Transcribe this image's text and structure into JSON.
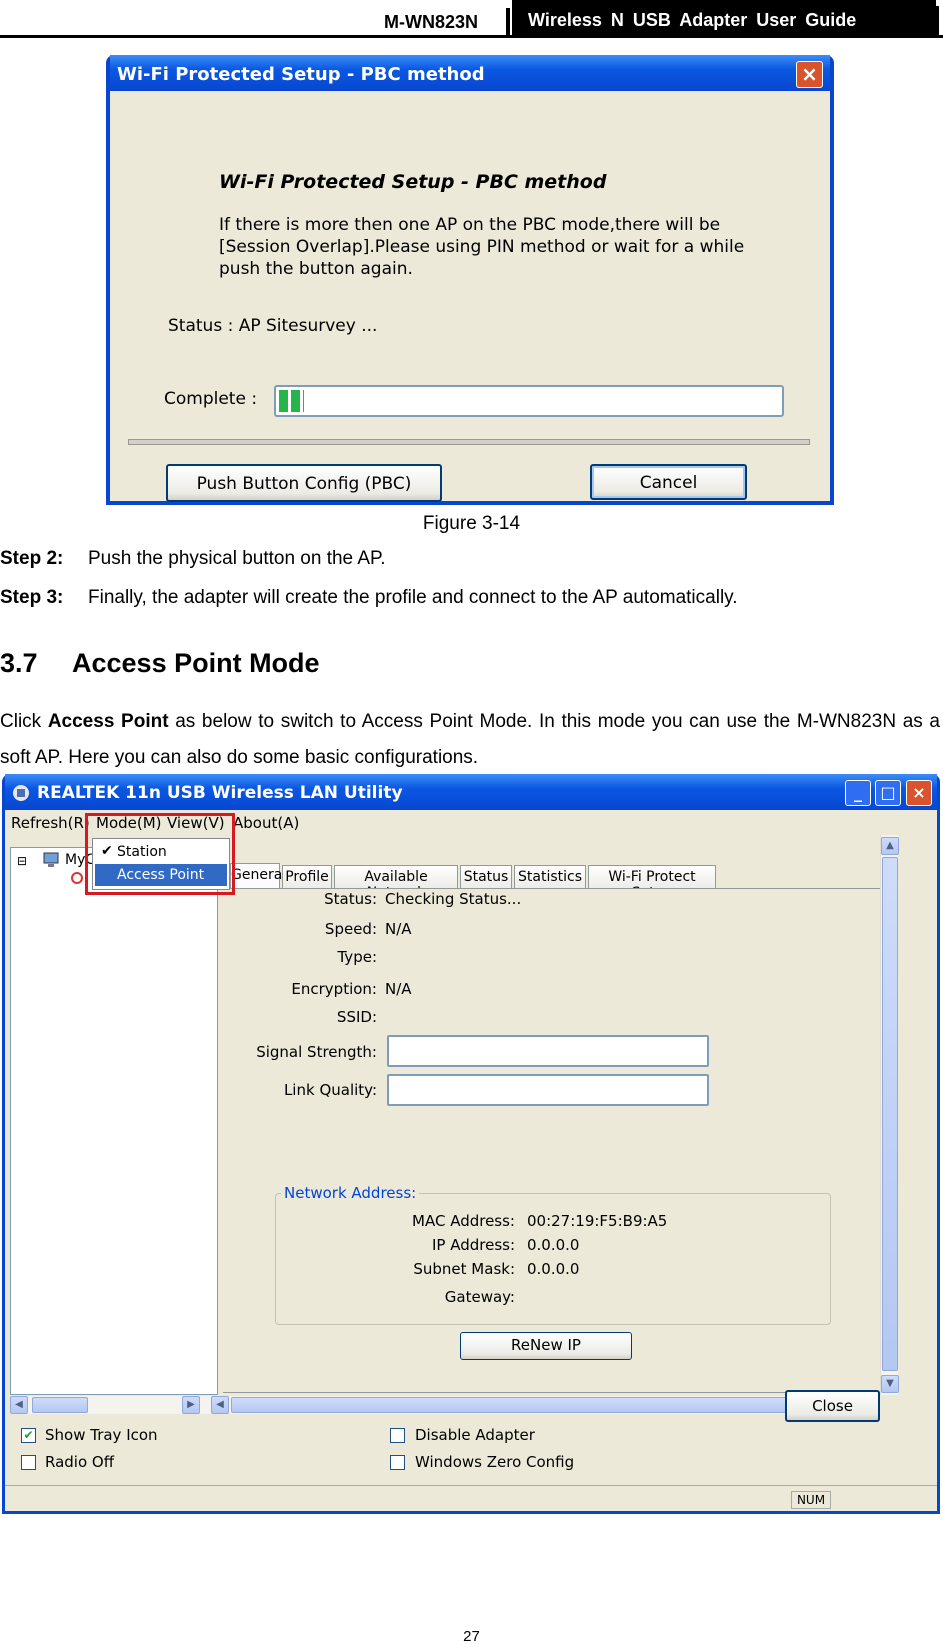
{
  "header": {
    "model": "M-WN823N",
    "guide": "Wireless N USB Adapter User Guide"
  },
  "dialog1": {
    "title": "Wi-Fi Protected Setup - PBC method",
    "close_icon": "close-icon",
    "heading": "Wi-Fi Protected Setup - PBC method",
    "message": "If there is more then one AP on the PBC mode,there will be [Session Overlap].Please using PIN method or wait for a while push the button again.",
    "status": "Status : AP Sitesurvey ...",
    "complete_label": "Complete :",
    "progress": 0.05,
    "pbc_button": "Push Button Config (PBC)",
    "cancel_button": "Cancel"
  },
  "caption": "Figure 3-14",
  "steps": [
    {
      "label": "Step 2:",
      "text": "Push the physical button on the AP."
    },
    {
      "label": "Step 3:",
      "text": "Finally, the adapter will create the profile and connect to the AP automatically."
    }
  ],
  "section": {
    "number": "3.7",
    "title": "Access Point Mode"
  },
  "paragraph": {
    "pre": "Click ",
    "bold": "Access Point",
    "post": " as below to switch to Access Point Mode. In this mode you can use the M-WN823N as a soft AP. Here you can also do some basic configurations."
  },
  "utility": {
    "title": "REALTEK 11n USB Wireless LAN Utility",
    "menus": [
      "Refresh(R)",
      "Mode(M)",
      "View(V)",
      "About(A)"
    ],
    "mode_menu": {
      "items": [
        "Station",
        "Access Point"
      ],
      "checked": "Station",
      "highlighted": "Access Point"
    },
    "tree_item": "MyC",
    "tabs": [
      "General",
      "Profile",
      "Available Network",
      "Status",
      "Statistics",
      "Wi-Fi Protect Setup"
    ],
    "fields": [
      {
        "label": "Status:",
        "value": "Checking Status..."
      },
      {
        "label": "Speed:",
        "value": "N/A"
      },
      {
        "label": "Type:",
        "value": ""
      },
      {
        "label": "Encryption:",
        "value": "N/A"
      },
      {
        "label": "SSID:",
        "value": ""
      },
      {
        "label": "Signal Strength:",
        "value": ""
      },
      {
        "label": "Link Quality:",
        "value": ""
      }
    ],
    "network_address": {
      "title": "Network Address:",
      "rows": [
        {
          "label": "MAC Address:",
          "value": "00:27:19:F5:B9:A5"
        },
        {
          "label": "IP Address:",
          "value": "0.0.0.0"
        },
        {
          "label": "Subnet Mask:",
          "value": "0.0.0.0"
        },
        {
          "label": "Gateway:",
          "value": ""
        }
      ]
    },
    "renew_button": "ReNew IP",
    "checkboxes": [
      {
        "label": "Show Tray Icon",
        "checked": true
      },
      {
        "label": "Radio Off",
        "checked": false
      },
      {
        "label": "Disable Adapter",
        "checked": false
      },
      {
        "label": "Windows Zero Config",
        "checked": false
      }
    ],
    "close_button": "Close",
    "status_num": "NUM"
  },
  "page_number": "27"
}
